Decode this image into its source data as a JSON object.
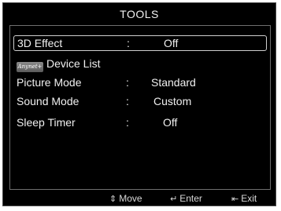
{
  "window": {
    "title": "TOOLS"
  },
  "menu": {
    "items": [
      {
        "label": "3D Effect",
        "separator": ":",
        "value": "Off"
      },
      {
        "label": "Device List",
        "logo_text": "Anynet+"
      },
      {
        "label": "Picture Mode",
        "separator": ":",
        "value": "Standard"
      },
      {
        "label": "Sound Mode",
        "separator": ":",
        "value": "Custom"
      },
      {
        "label": "Sleep Timer",
        "separator": ":",
        "value": "Off"
      }
    ],
    "selected_index": 0
  },
  "footer": {
    "move_label": "Move",
    "move_icon": "up-down-arrow-icon",
    "enter_label": "Enter",
    "enter_icon": "enter-icon",
    "exit_label": "Exit",
    "exit_icon": "exit-icon"
  }
}
